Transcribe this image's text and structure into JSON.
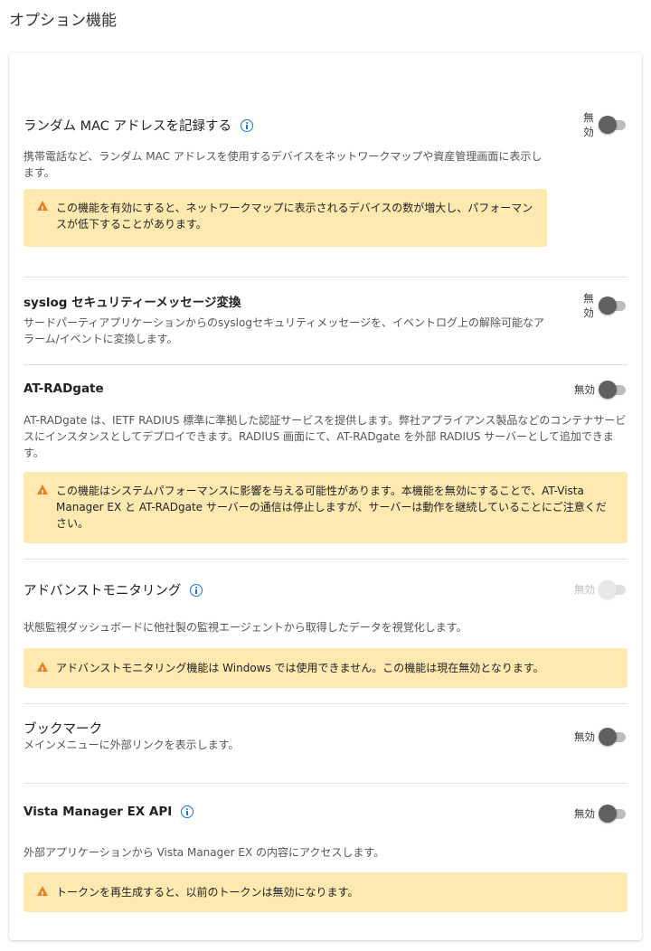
{
  "page": {
    "title": "オプション機能"
  },
  "features": {
    "random_mac": {
      "title": "ランダム MAC アドレスを記録する",
      "toggle_label": "無効",
      "description": "携帯電話など、ランダム MAC アドレスを使用するデバイスをネットワークマップや資産管理画面に表示します。",
      "warning": "この機能を有効にすると、ネットワークマップに表示されるデバイスの数が増大し、パフォーマンスが低下することがあります。"
    },
    "syslog": {
      "title": "syslog セキュリティーメッセージ変換",
      "toggle_label": "無効",
      "description": "サードパーティアプリケーションからのsyslogセキュリティメッセージを、イベントログ上の解除可能なアラーム/イベントに変換します。"
    },
    "radgate": {
      "title": "AT-RADgate",
      "toggle_label": "無効",
      "description": "AT-RADgate は、IETF RADIUS 標準に準拠した認証サービスを提供します。弊社アプライアンス製品などのコンテナサービスにインスタンスとしてデプロイできます。RADIUS 画面にて、AT-RADgate を外部 RADIUS サーバーとして追加できます。",
      "warning": "この機能はシステムパフォーマンスに影響を与える可能性があります。本機能を無効にすることで、AT-Vista Manager EX と AT-RADgate サーバーの通信は停止しますが、サーバーは動作を継続していることにご注意ください。"
    },
    "advanced_monitoring": {
      "title": "アドバンストモニタリング",
      "toggle_label": "無効",
      "description": "状態監視ダッシュボードに他社製の監視エージェントから取得したデータを視覚化します。",
      "warning": "アドバンストモニタリング機能は Windows では使用できません。この機能は現在無効となります。"
    },
    "bookmark": {
      "title": "ブックマーク",
      "toggle_label": "無効",
      "description": "メインメニューに外部リンクを表示します。"
    },
    "api": {
      "title": "Vista Manager EX API",
      "toggle_label": "無効",
      "description": "外部アプリケーションから Vista Manager EX の内容にアクセスします。",
      "warning": "トークンを再生成すると、以前のトークンは無効になります。"
    }
  },
  "colors": {
    "warning_bg": "#feeab0",
    "warning_icon": "#e8821e",
    "info_icon": "#1976d2",
    "toggle_knob_off": "#606060"
  },
  "toggle_states": {
    "random_mac": "off",
    "syslog": "off",
    "radgate": "off",
    "advanced_monitoring": "disabled",
    "bookmark": "off",
    "api": "off"
  }
}
